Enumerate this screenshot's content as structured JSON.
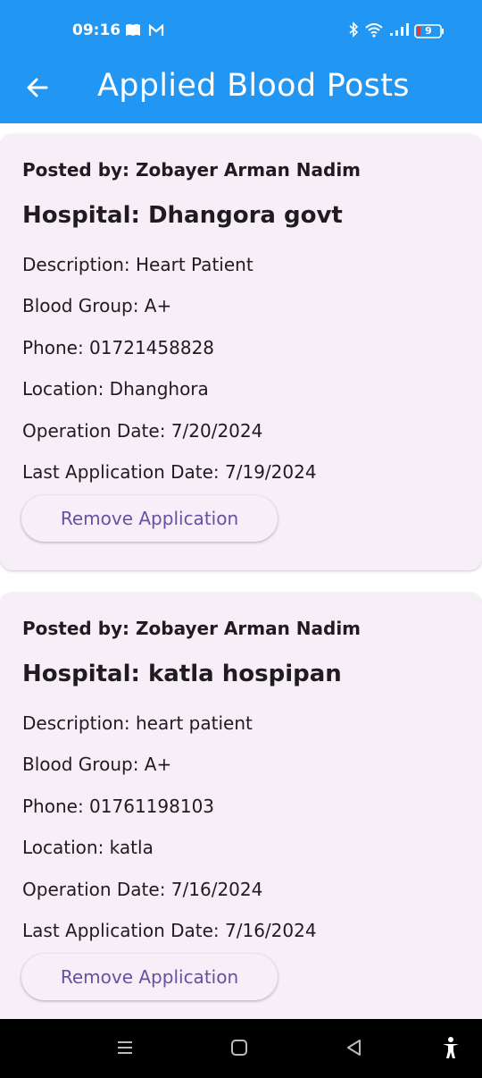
{
  "status_bar": {
    "time": "09:16",
    "battery": "9",
    "icons": [
      "book-icon",
      "gmail-icon",
      "bluetooth-icon",
      "wifi-icon",
      "signal-icon",
      "battery-icon"
    ]
  },
  "app_bar": {
    "title": "Applied Blood Posts",
    "back_icon": "arrow-left-icon"
  },
  "posts": [
    {
      "posted_by": "Posted by: Zobayer Arman Nadim",
      "hospital": "Hospital: Dhangora govt",
      "description": "Description: Heart Patient",
      "blood_group": "Blood Group: A+",
      "phone": "Phone: 01721458828",
      "location": "Location: Dhanghora",
      "operation_date": "Operation Date: 7/20/2024",
      "last_application_date": "Last Application Date: 7/19/2024",
      "button_label": "Remove Application"
    },
    {
      "posted_by": "Posted by: Zobayer Arman Nadim",
      "hospital": "Hospital: katla hospipan",
      "description": "Description: heart patient",
      "blood_group": "Blood Group: A+",
      "phone": "Phone: 01761198103",
      "location": "Location: katla",
      "operation_date": "Operation Date: 7/16/2024",
      "last_application_date": "Last Application Date: 7/16/2024",
      "button_label": "Remove Application"
    }
  ],
  "colors": {
    "app_bar": "#2196f3",
    "card_bg": "#f7eff8",
    "button_text": "#6750a4",
    "nav_bar": "#000000"
  },
  "nav_bar": {
    "icons": [
      "menu-icon",
      "home-square-icon",
      "back-triangle-icon",
      "accessibility-icon"
    ]
  }
}
